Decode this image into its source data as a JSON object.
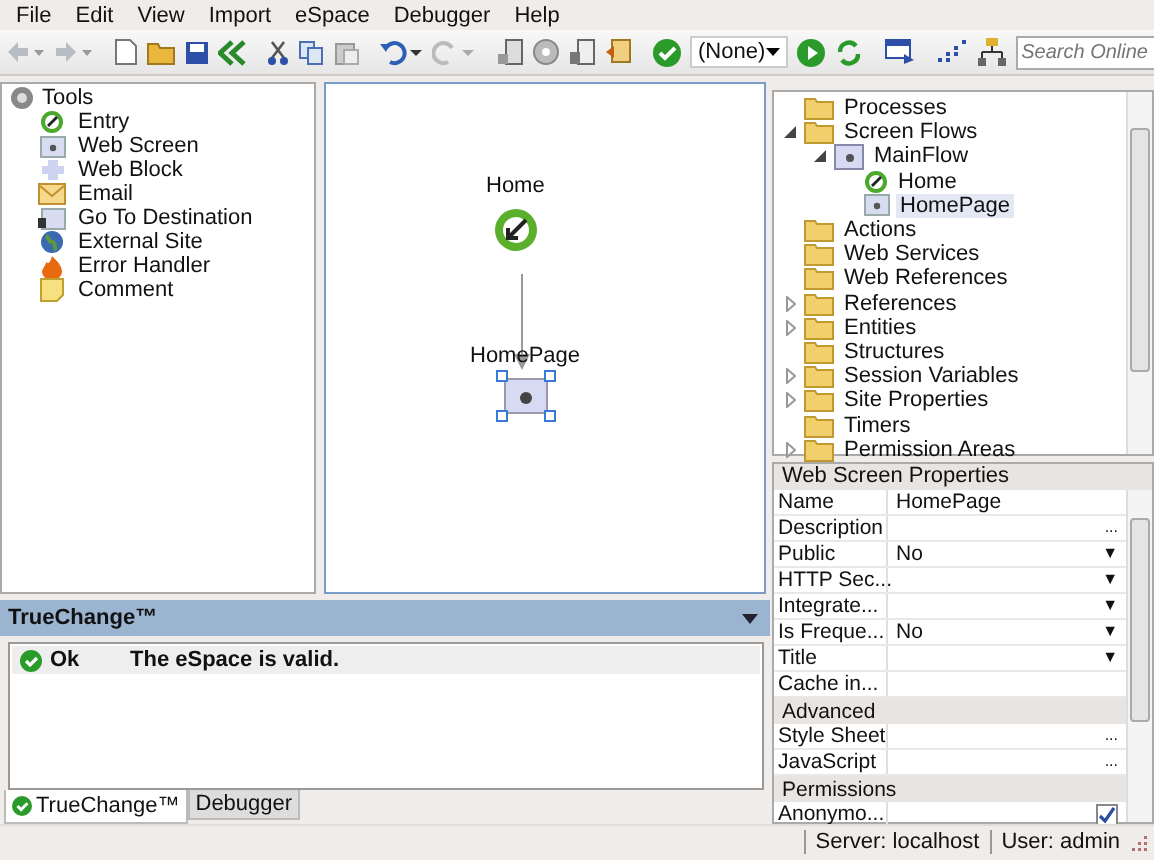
{
  "menu": [
    "File",
    "Edit",
    "View",
    "Import",
    "eSpace",
    "Debugger",
    "Help"
  ],
  "toolbar": {
    "dropdown": "(None)",
    "search": {
      "placeholder": "Search Online"
    }
  },
  "tools": {
    "title": "Tools",
    "items": [
      {
        "label": "Entry",
        "kind": "entry"
      },
      {
        "label": "Web Screen",
        "kind": "screen"
      },
      {
        "label": "Web Block",
        "kind": "block"
      },
      {
        "label": "Email",
        "kind": "email"
      },
      {
        "label": "Go To Destination",
        "kind": "goto"
      },
      {
        "label": "External Site",
        "kind": "globe"
      },
      {
        "label": "Error Handler",
        "kind": "error"
      },
      {
        "label": "Comment",
        "kind": "comment"
      }
    ]
  },
  "canvas": {
    "nodes": [
      {
        "label": "Home",
        "kind": "entry",
        "selected": false
      },
      {
        "label": "HomePage",
        "kind": "screen",
        "selected": true
      }
    ]
  },
  "tree": [
    {
      "label": "Processes",
      "kind": "folder",
      "selected": false
    },
    {
      "label": "Screen Flows",
      "kind": "folder",
      "selected": false,
      "expanded": true,
      "children": [
        {
          "label": "MainFlow",
          "kind": "flow",
          "selected": false,
          "expanded": true,
          "children": [
            {
              "label": "Home",
              "kind": "entry",
              "selected": false
            },
            {
              "label": "HomePage",
              "kind": "screen",
              "selected": true
            }
          ]
        }
      ]
    },
    {
      "label": "Actions",
      "kind": "folder",
      "selected": false
    },
    {
      "label": "Web Services",
      "kind": "folder",
      "selected": false
    },
    {
      "label": "Web References",
      "kind": "folder",
      "selected": false
    },
    {
      "label": "References",
      "kind": "folder",
      "selected": false,
      "expanded": false
    },
    {
      "label": "Entities",
      "kind": "folder",
      "selected": false,
      "expanded": false
    },
    {
      "label": "Structures",
      "kind": "folder",
      "selected": false
    },
    {
      "label": "Session Variables",
      "kind": "folder",
      "selected": false,
      "expanded": false
    },
    {
      "label": "Site Properties",
      "kind": "folder",
      "selected": false,
      "expanded": false
    },
    {
      "label": "Timers",
      "kind": "folder",
      "selected": false
    },
    {
      "label": "Permission Areas",
      "kind": "folder",
      "selected": false,
      "expanded": false
    }
  ],
  "properties": {
    "title": "Web Screen Properties",
    "rows": [
      {
        "kind": "prop",
        "name": "Name",
        "value": "HomePage"
      },
      {
        "kind": "prop",
        "name": "Description",
        "button": "..."
      },
      {
        "kind": "prop",
        "name": "Public",
        "value": "No",
        "button": "▼"
      },
      {
        "kind": "prop",
        "name": "HTTP Sec...",
        "button": "▼"
      },
      {
        "kind": "prop",
        "name": "Integrate...",
        "button": "▼"
      },
      {
        "kind": "prop",
        "name": "Is Freque...",
        "value": "No",
        "button": "▼"
      },
      {
        "kind": "prop",
        "name": "Title",
        "button": "▼"
      },
      {
        "kind": "prop",
        "name": "Cache in..."
      },
      {
        "kind": "section",
        "name": "Advanced"
      },
      {
        "kind": "prop",
        "name": "Style Sheet",
        "button": "..."
      },
      {
        "kind": "prop",
        "name": "JavaScript",
        "button": "..."
      },
      {
        "kind": "section",
        "name": "Permissions"
      },
      {
        "kind": "prop",
        "name": "Anonymo...",
        "checked": true
      }
    ]
  },
  "truechange": {
    "title": "TrueChange™",
    "messages": [
      {
        "status": "Ok",
        "text": "The eSpace is valid."
      }
    ],
    "tabs": [
      {
        "label": "TrueChange™",
        "selected": true
      },
      {
        "label": "Debugger",
        "selected": false
      }
    ]
  },
  "status_bar": [
    "Server: localhost",
    "User: admin"
  ]
}
